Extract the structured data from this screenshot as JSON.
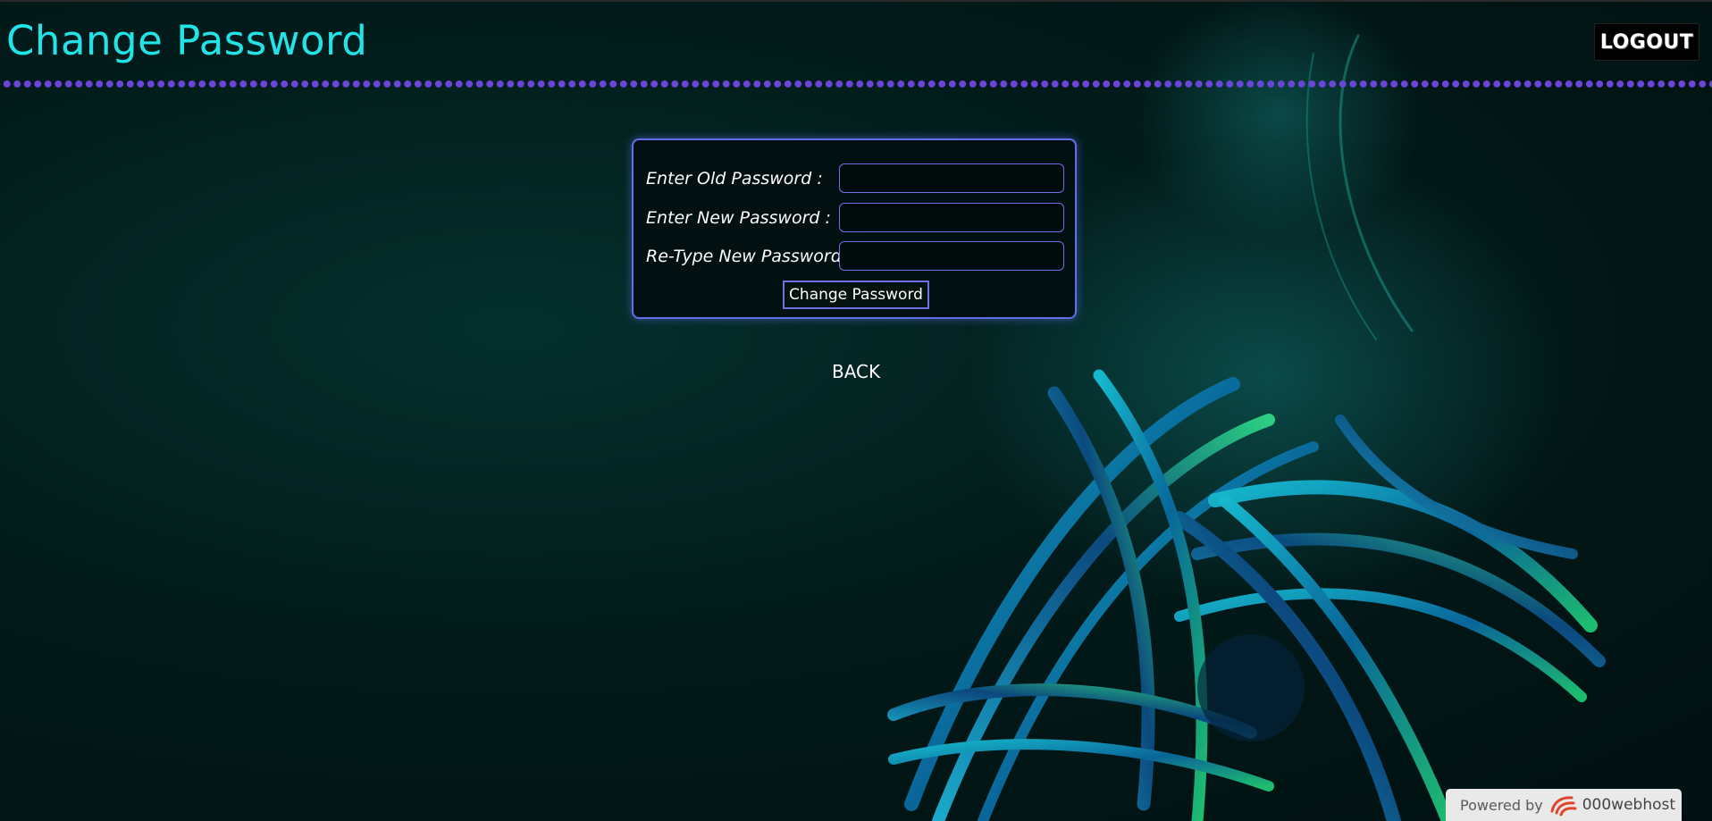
{
  "header": {
    "title": "Change Password",
    "logout_label": "LOGOUT"
  },
  "form": {
    "old_password_label": "Enter Old Password :",
    "new_password_label": "Enter New Password :",
    "retype_password_label": "Re-Type New Password :",
    "old_password_value": "",
    "new_password_value": "",
    "retype_password_value": "",
    "submit_label": "Change Password"
  },
  "nav": {
    "back_label": "BACK"
  },
  "footer": {
    "powered_by_label": "Powered by",
    "brand_name": "000webhost",
    "brand_icon": "000webhost-logo-icon"
  },
  "colors": {
    "title": "#22e4e8",
    "dots": "#6a45d8",
    "box_border": "#6170e8",
    "background": "#021b1a"
  }
}
